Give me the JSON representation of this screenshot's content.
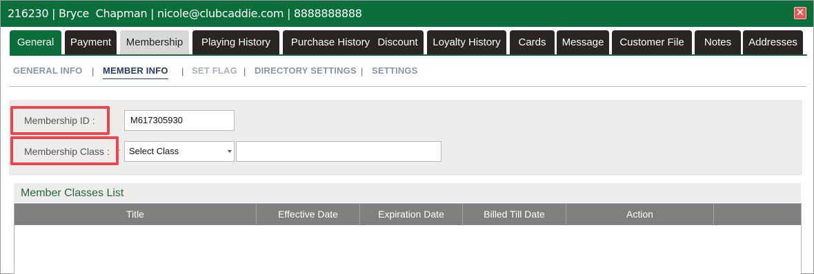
{
  "window": {
    "title": "216230 | Bryce  Chapman | nicole@clubcaddie.com | 8888888888",
    "close_glyph": "✕",
    "close_color": "#e05a5a",
    "brand_color": "#0c6e3b"
  },
  "tabs": [
    {
      "label": "General"
    },
    {
      "label": "Payment"
    },
    {
      "label": "Membership"
    },
    {
      "label": "Playing History"
    },
    {
      "label": "Purchase History"
    },
    {
      "label": "Discount"
    },
    {
      "label": "Loyalty History"
    },
    {
      "label": "Cards"
    },
    {
      "label": "Message"
    },
    {
      "label": "Customer File"
    },
    {
      "label": "Notes"
    },
    {
      "label": "Addresses"
    }
  ],
  "active_tab": "Membership",
  "subnav": {
    "items": [
      {
        "label": "GENERAL INFO"
      },
      {
        "label": "MEMBER INFO"
      },
      {
        "label": "SET FLAG"
      },
      {
        "label": "DIRECTORY SETTINGS"
      },
      {
        "label": "SETTINGS"
      }
    ],
    "separator": "|",
    "active": "MEMBER INFO"
  },
  "form": {
    "membership_id_label": "Membership ID :",
    "membership_id_value": "M617305930",
    "membership_class_label": "Membership Class :",
    "membership_class_selected": "Select Class",
    "membership_class_extra_value": "",
    "highlight_color": "#e8474f"
  },
  "member_classes": {
    "caption": "Member Classes List",
    "columns": [
      "Title",
      "Effective Date",
      "Expiration Date",
      "Billed Till Date",
      "Action",
      ""
    ],
    "rows": []
  }
}
